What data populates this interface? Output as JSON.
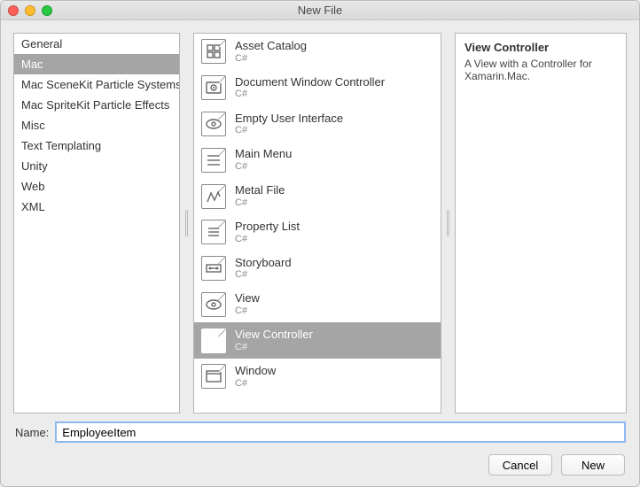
{
  "window": {
    "title": "New File"
  },
  "categories": [
    {
      "label": "General",
      "selected": false
    },
    {
      "label": "Mac",
      "selected": true
    },
    {
      "label": "Mac SceneKit Particle Systems",
      "selected": false
    },
    {
      "label": "Mac SpriteKit Particle Effects",
      "selected": false
    },
    {
      "label": "Misc",
      "selected": false
    },
    {
      "label": "Text Templating",
      "selected": false
    },
    {
      "label": "Unity",
      "selected": false
    },
    {
      "label": "Web",
      "selected": false
    },
    {
      "label": "XML",
      "selected": false
    }
  ],
  "templates": [
    {
      "name": "Asset Catalog",
      "sub": "C#",
      "icon": "asset-catalog-icon",
      "selected": false
    },
    {
      "name": "Document Window Controller",
      "sub": "C#",
      "icon": "window-controller-icon",
      "selected": false
    },
    {
      "name": "Empty User Interface",
      "sub": "C#",
      "icon": "empty-ui-icon",
      "selected": false
    },
    {
      "name": "Main Menu",
      "sub": "C#",
      "icon": "menu-icon",
      "selected": false
    },
    {
      "name": "Metal File",
      "sub": "C#",
      "icon": "metal-icon",
      "selected": false
    },
    {
      "name": "Property List",
      "sub": "C#",
      "icon": "plist-icon",
      "selected": false
    },
    {
      "name": "Storyboard",
      "sub": "C#",
      "icon": "storyboard-icon",
      "selected": false
    },
    {
      "name": "View",
      "sub": "C#",
      "icon": "view-icon",
      "selected": false
    },
    {
      "name": "View Controller",
      "sub": "C#",
      "icon": "view-controller-icon",
      "selected": true
    },
    {
      "name": "Window",
      "sub": "C#",
      "icon": "window-icon",
      "selected": false
    }
  ],
  "description": {
    "title": "View Controller",
    "text": "A View with a Controller for Xamarin.Mac."
  },
  "name_field": {
    "label": "Name:",
    "value": "EmployeeItem"
  },
  "buttons": {
    "cancel": "Cancel",
    "new": "New"
  }
}
